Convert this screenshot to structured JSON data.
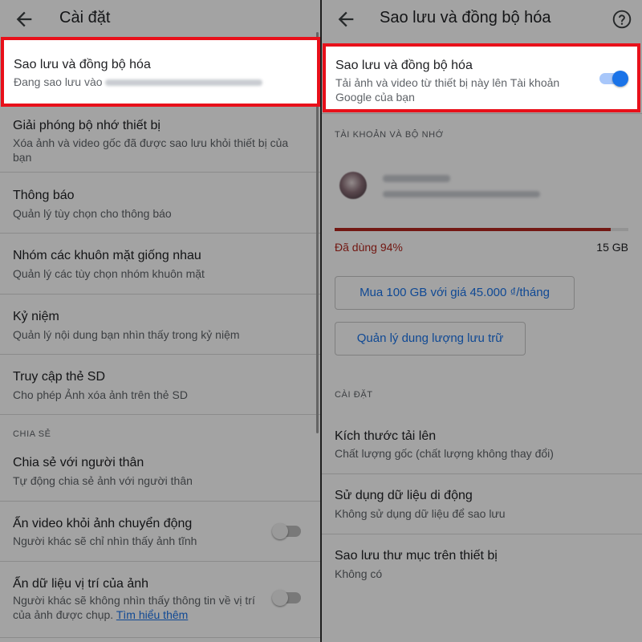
{
  "left": {
    "title": "Cài đặt",
    "backup_row": {
      "title": "Sao lưu và đồng bộ hóa",
      "subtitle_prefix": "Đang sao lưu vào"
    },
    "free_space": {
      "title": "Giải phóng bộ nhớ thiết bị",
      "subtitle": "Xóa ảnh và video gốc đã được sao lưu khỏi thiết bị của bạn"
    },
    "notifications": {
      "title": "Thông báo",
      "subtitle": "Quản lý tùy chọn cho thông báo"
    },
    "face_groups": {
      "title": "Nhóm các khuôn mặt giống nhau",
      "subtitle": "Quản lý các tùy chọn nhóm khuôn mặt"
    },
    "memories": {
      "title": "Kỷ niệm",
      "subtitle": "Quản lý nội dung bạn nhìn thấy trong kỷ niệm"
    },
    "sd_access": {
      "title": "Truy cập thẻ SD",
      "subtitle": "Cho phép Ảnh xóa ảnh trên thẻ SD"
    },
    "section_sharing": "CHIA SẺ",
    "partner_share": {
      "title": "Chia sẻ với người thân",
      "subtitle": "Tự động chia sẻ ảnh với người thân"
    },
    "hide_motion": {
      "title": "Ẩn video khỏi ảnh chuyển động",
      "subtitle": "Người khác sẽ chỉ nhìn thấy ảnh tĩnh",
      "enabled": false
    },
    "hide_location": {
      "title": "Ẩn dữ liệu vị trí của ảnh",
      "subtitle": "Người khác sẽ không nhìn thấy thông tin về vị trí của ảnh được chụp.",
      "link": "Tìm hiểu thêm",
      "enabled": false
    }
  },
  "right": {
    "title": "Sao lưu và đồng bộ hóa",
    "help_icon": "help-circle-icon",
    "backup_toggle": {
      "title": "Sao lưu và đồng bộ hóa",
      "subtitle": "Tải ảnh và video từ thiết bị này lên Tài khoản Google của bạn",
      "enabled": true
    },
    "section_account": "TÀI KHOẢN VÀ BỘ NHỚ",
    "storage": {
      "used_label": "Đã dùng 94%",
      "used_fraction": 0.94,
      "total": "15 GB"
    },
    "buy_button": "Mua 100 GB với giá 45.000 ₫/tháng",
    "manage_button": "Quản lý dung lượng lưu trữ",
    "section_settings": "CÀI ĐẶT",
    "upload_size": {
      "title": "Kích thước tải lên",
      "subtitle": "Chất lượng gốc (chất lượng không thay đổi)"
    },
    "mobile_data": {
      "title": "Sử dụng dữ liệu di động",
      "subtitle": "Không sử dụng dữ liệu để sao lưu"
    },
    "device_folders": {
      "title": "Sao lưu thư mục trên thiết bị",
      "subtitle": "Không có"
    }
  },
  "colors": {
    "highlight": "#e8101a",
    "accent": "#1a73e8",
    "storage_used": "#b3261e"
  }
}
